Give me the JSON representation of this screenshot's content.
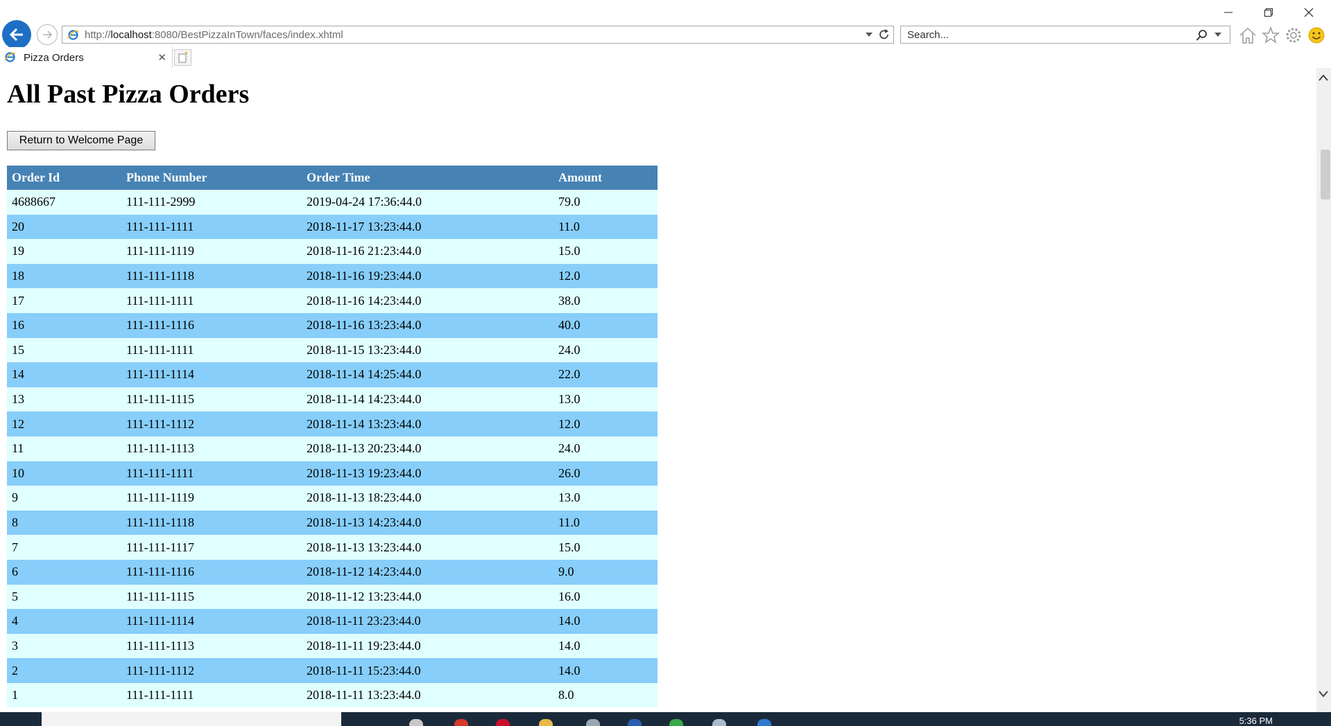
{
  "browser": {
    "url_prefix": "http://",
    "url_host": "localhost",
    "url_path": ":8080/BestPizzaInTown/faces/index.xhtml",
    "search_placeholder": "Search...",
    "tab_title": "Pizza Orders"
  },
  "page": {
    "title": "All Past Pizza Orders",
    "return_button_label": "Return to Welcome Page"
  },
  "table": {
    "columns": [
      "Order Id",
      "Phone Number",
      "Order Time",
      "Amount"
    ],
    "rows": [
      [
        "4688667",
        "111-111-2999",
        "2019-04-24 17:36:44.0",
        "79.0"
      ],
      [
        "20",
        "111-111-1111",
        "2018-11-17 13:23:44.0",
        "11.0"
      ],
      [
        "19",
        "111-111-1119",
        "2018-11-16 21:23:44.0",
        "15.0"
      ],
      [
        "18",
        "111-111-1118",
        "2018-11-16 19:23:44.0",
        "12.0"
      ],
      [
        "17",
        "111-111-1111",
        "2018-11-16 14:23:44.0",
        "38.0"
      ],
      [
        "16",
        "111-111-1116",
        "2018-11-16 13:23:44.0",
        "40.0"
      ],
      [
        "15",
        "111-111-1111",
        "2018-11-15 13:23:44.0",
        "24.0"
      ],
      [
        "14",
        "111-111-1114",
        "2018-11-14 14:25:44.0",
        "22.0"
      ],
      [
        "13",
        "111-111-1115",
        "2018-11-14 14:23:44.0",
        "13.0"
      ],
      [
        "12",
        "111-111-1112",
        "2018-11-14 13:23:44.0",
        "12.0"
      ],
      [
        "11",
        "111-111-1113",
        "2018-11-13 20:23:44.0",
        "24.0"
      ],
      [
        "10",
        "111-111-1111",
        "2018-11-13 19:23:44.0",
        "26.0"
      ],
      [
        "9",
        "111-111-1119",
        "2018-11-13 18:23:44.0",
        "13.0"
      ],
      [
        "8",
        "111-111-1118",
        "2018-11-13 14:23:44.0",
        "11.0"
      ],
      [
        "7",
        "111-111-1117",
        "2018-11-13 13:23:44.0",
        "15.0"
      ],
      [
        "6",
        "111-111-1116",
        "2018-11-12 14:23:44.0",
        "9.0"
      ],
      [
        "5",
        "111-111-1115",
        "2018-11-12 13:23:44.0",
        "16.0"
      ],
      [
        "4",
        "111-111-1114",
        "2018-11-11 23:23:44.0",
        "14.0"
      ],
      [
        "3",
        "111-111-1113",
        "2018-11-11 19:23:44.0",
        "14.0"
      ],
      [
        "2",
        "111-111-1112",
        "2018-11-11 15:23:44.0",
        "14.0"
      ],
      [
        "1",
        "111-111-1111",
        "2018-11-11 13:23:44.0",
        "8.0"
      ]
    ]
  },
  "taskbar": {
    "time": "5:36 PM"
  },
  "icons": {
    "back": "back-arrow-icon",
    "forward": "forward-arrow-icon",
    "refresh": "refresh-icon",
    "search": "magnifier-icon",
    "home": "home-icon",
    "favorites": "star-icon",
    "settings": "gear-icon",
    "feedback": "smiley-icon"
  },
  "colors": {
    "header_bg": "#4682b4",
    "row_odd": "#e0ffff",
    "row_even": "#87cefa",
    "back_button": "#1e6fc4"
  }
}
